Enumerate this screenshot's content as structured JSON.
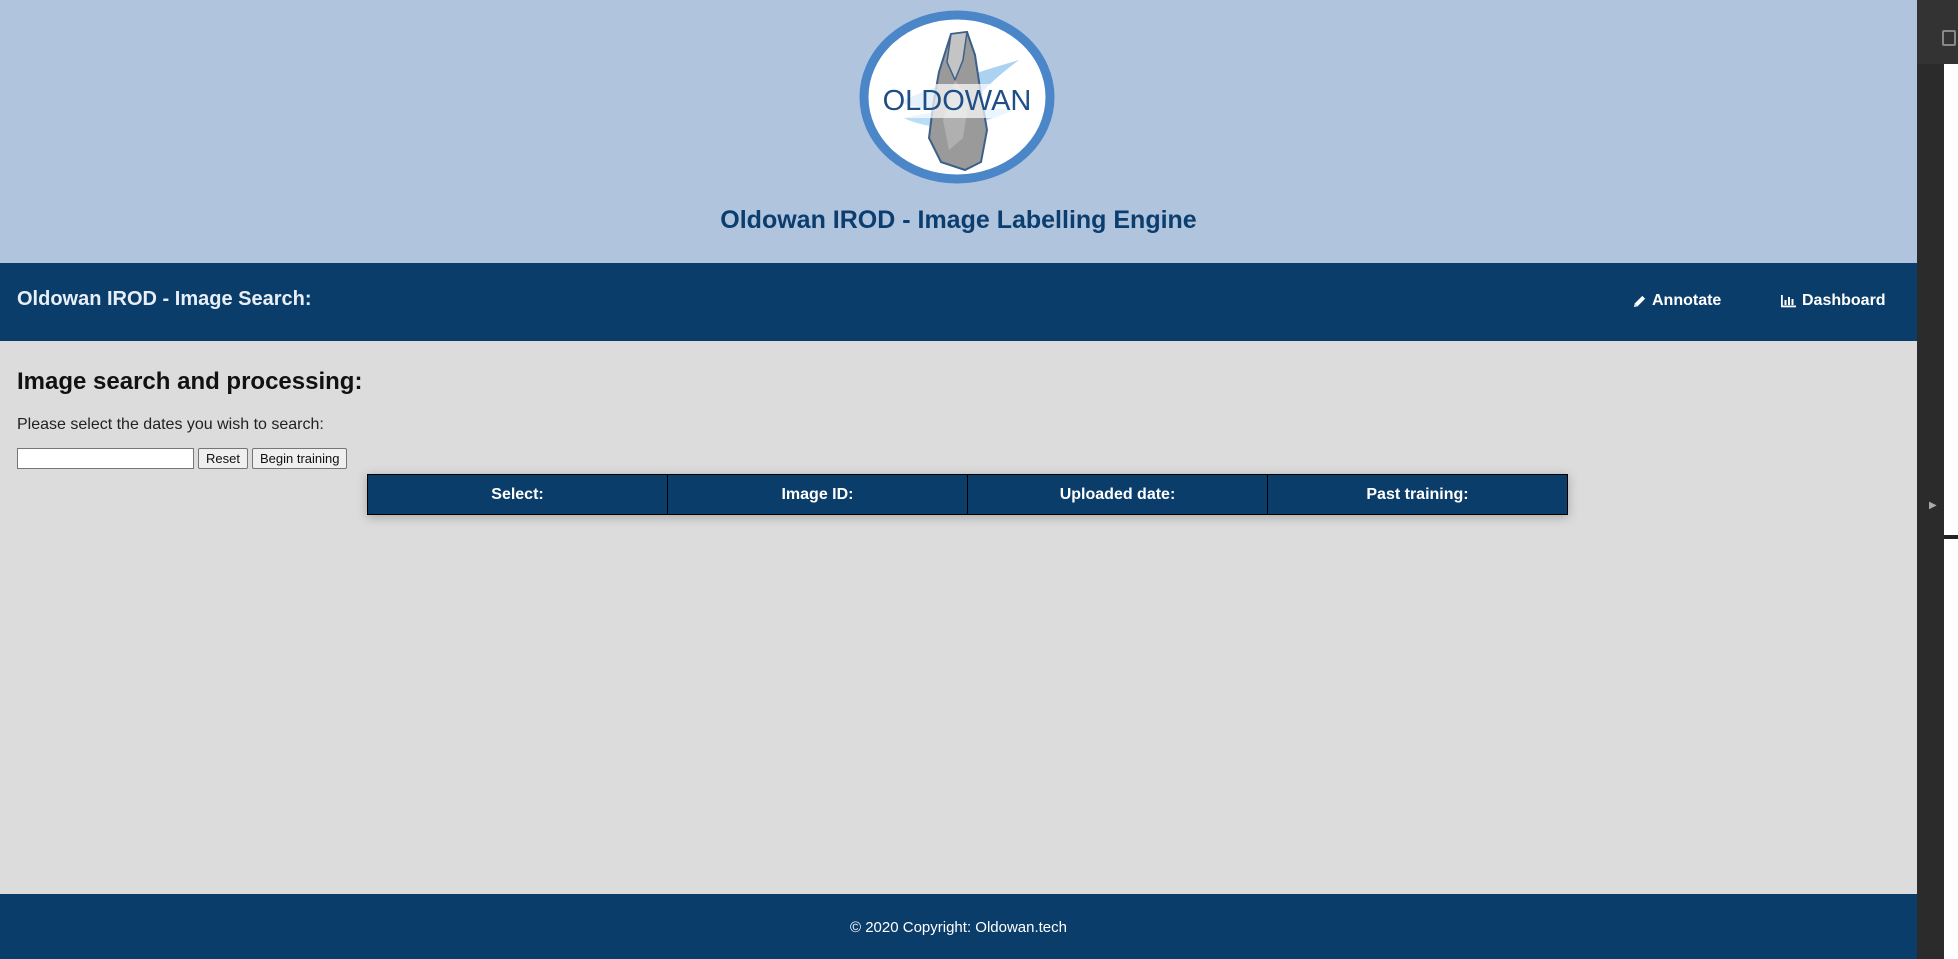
{
  "banner": {
    "logo_text": "OLDOWAN",
    "site_title": "Oldowan IROD - Image Labelling Engine"
  },
  "navbar": {
    "title": "Oldowan IROD - Image Search:",
    "links": [
      {
        "label": "Annotate",
        "icon": "pencil-icon"
      },
      {
        "label": "Dashboard",
        "icon": "bar-chart-icon"
      }
    ]
  },
  "main": {
    "heading": "Image search and processing:",
    "hint": "Please select the dates you wish to search:",
    "date_input_value": "",
    "reset_label": "Reset",
    "begin_training_label": "Begin training",
    "table": {
      "columns": [
        "Select:",
        "Image ID:",
        "Uploaded date:",
        "Past training:"
      ],
      "rows": []
    }
  },
  "footer": {
    "copyright": "© 2020 Copyright: Oldowan.tech"
  },
  "colors": {
    "banner_bg": "#b0c4de",
    "navbar_bg": "#0b3d6b",
    "accent_title": "#0b3d6e",
    "page_bg": "#dcdcdc"
  }
}
